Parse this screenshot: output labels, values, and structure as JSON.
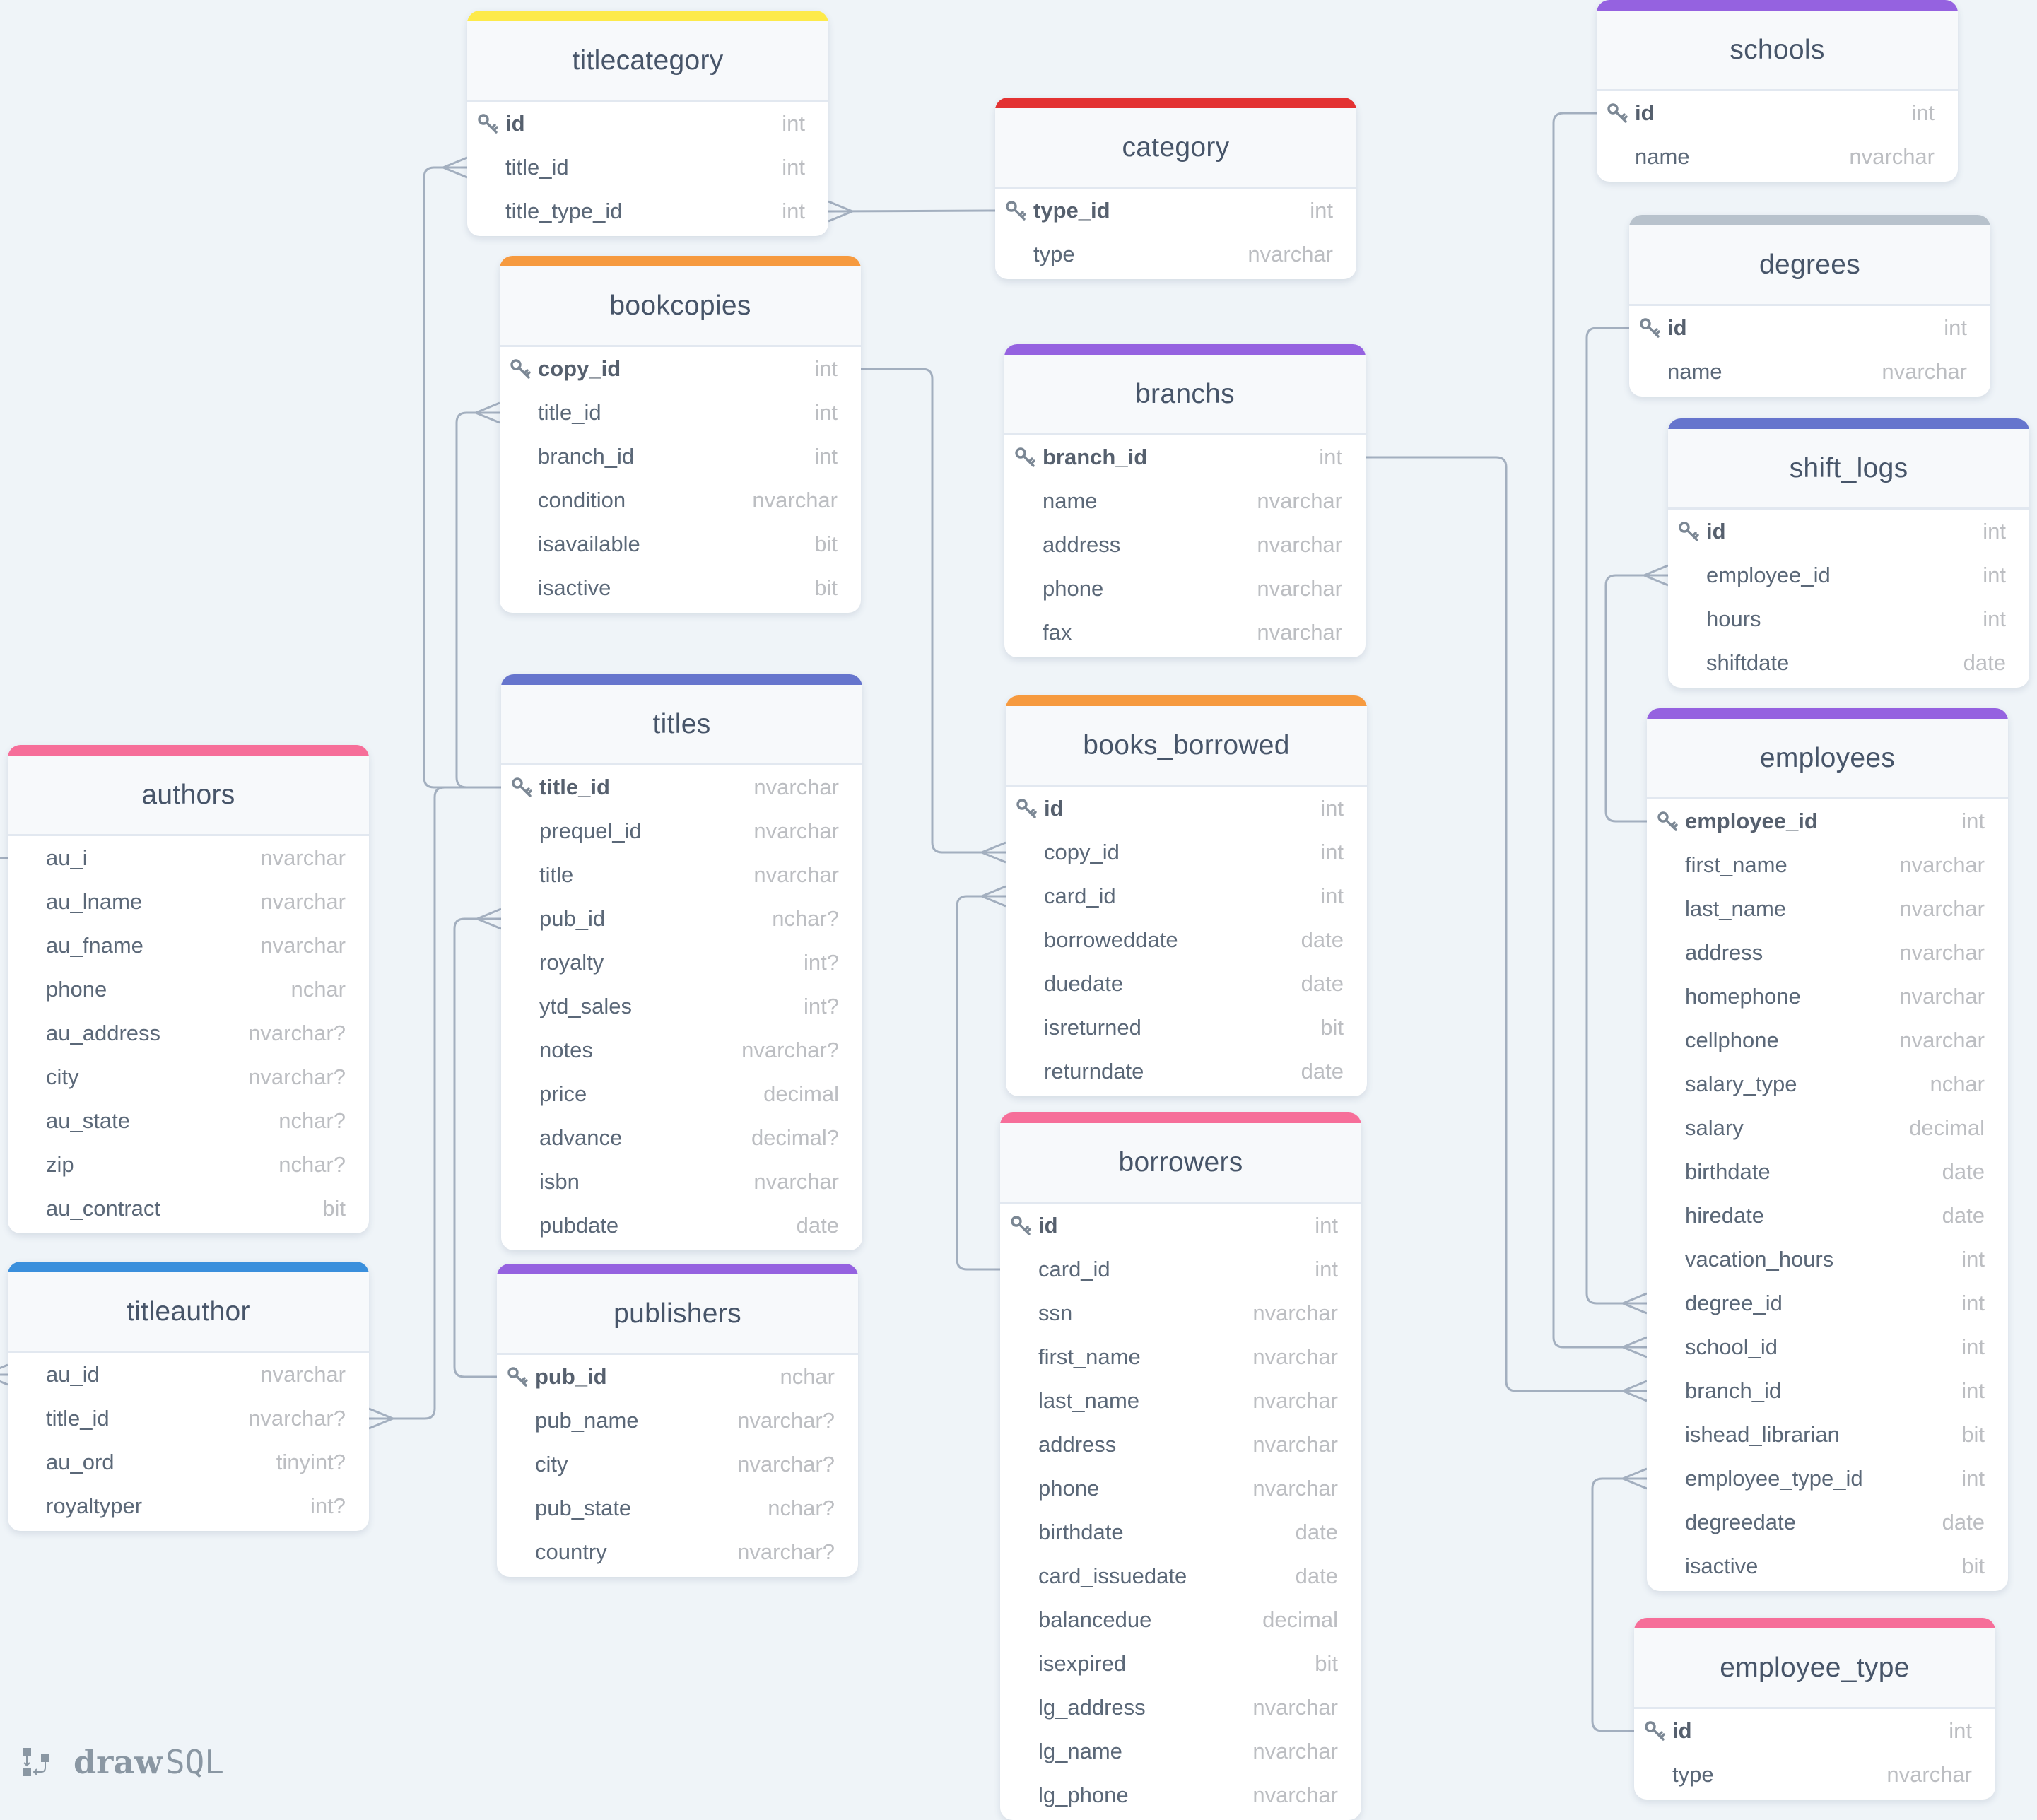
{
  "app": {
    "brand_bold": "draw",
    "brand_light": "SQL"
  },
  "colors": {
    "yellow": "#fdea4a",
    "red": "#e33232",
    "orange": "#f69a3f",
    "purple": "#9562e0",
    "indigo": "#6675cd",
    "pink": "#f66e99",
    "blue": "#3a8fdc",
    "gray": "#b8c2cc",
    "wire": "#a3afbf"
  },
  "tables": [
    {
      "id": "titlecategory",
      "name": "titlecategory",
      "color": "yellow",
      "columns": [
        {
          "name": "id",
          "type": "int",
          "pk": true
        },
        {
          "name": "title_id",
          "type": "int"
        },
        {
          "name": "title_type_id",
          "type": "int"
        }
      ]
    },
    {
      "id": "category",
      "name": "category",
      "color": "red",
      "columns": [
        {
          "name": "type_id",
          "type": "int",
          "pk": true
        },
        {
          "name": "type",
          "type": "nvarchar"
        }
      ]
    },
    {
      "id": "bookcopies",
      "name": "bookcopies",
      "color": "orange",
      "columns": [
        {
          "name": "copy_id",
          "type": "int",
          "pk": true
        },
        {
          "name": "title_id",
          "type": "int"
        },
        {
          "name": "branch_id",
          "type": "int"
        },
        {
          "name": "condition",
          "type": "nvarchar"
        },
        {
          "name": "isavailable",
          "type": "bit"
        },
        {
          "name": "isactive",
          "type": "bit"
        }
      ]
    },
    {
      "id": "branchs",
      "name": "branchs",
      "color": "purple",
      "columns": [
        {
          "name": "branch_id",
          "type": "int",
          "pk": true
        },
        {
          "name": "name",
          "type": "nvarchar"
        },
        {
          "name": "address",
          "type": "nvarchar"
        },
        {
          "name": "phone",
          "type": "nvarchar"
        },
        {
          "name": "fax",
          "type": "nvarchar"
        }
      ]
    },
    {
      "id": "titles",
      "name": "titles",
      "color": "indigo",
      "columns": [
        {
          "name": "title_id",
          "type": "nvarchar",
          "pk": true
        },
        {
          "name": "prequel_id",
          "type": "nvarchar"
        },
        {
          "name": "title",
          "type": "nvarchar"
        },
        {
          "name": "pub_id",
          "type": "nchar?"
        },
        {
          "name": "royalty",
          "type": "int?"
        },
        {
          "name": "ytd_sales",
          "type": "int?"
        },
        {
          "name": "notes",
          "type": "nvarchar?"
        },
        {
          "name": "price",
          "type": "decimal"
        },
        {
          "name": "advance",
          "type": "decimal?"
        },
        {
          "name": "isbn",
          "type": "nvarchar"
        },
        {
          "name": "pubdate",
          "type": "date"
        }
      ]
    },
    {
      "id": "books_borrowed",
      "name": "books_borrowed",
      "color": "orange",
      "columns": [
        {
          "name": "id",
          "type": "int",
          "pk": true
        },
        {
          "name": "copy_id",
          "type": "int"
        },
        {
          "name": "card_id",
          "type": "int"
        },
        {
          "name": "borroweddate",
          "type": "date"
        },
        {
          "name": "duedate",
          "type": "date"
        },
        {
          "name": "isreturned",
          "type": "bit"
        },
        {
          "name": "returndate",
          "type": "date"
        }
      ]
    },
    {
      "id": "borrowers",
      "name": "borrowers",
      "color": "pink",
      "columns": [
        {
          "name": "id",
          "type": "int",
          "pk": true
        },
        {
          "name": "card_id",
          "type": "int"
        },
        {
          "name": "ssn",
          "type": "nvarchar"
        },
        {
          "name": "first_name",
          "type": "nvarchar"
        },
        {
          "name": "last_name",
          "type": "nvarchar"
        },
        {
          "name": "address",
          "type": "nvarchar"
        },
        {
          "name": "phone",
          "type": "nvarchar"
        },
        {
          "name": "birthdate",
          "type": "date"
        },
        {
          "name": "card_issuedate",
          "type": "date"
        },
        {
          "name": "balancedue",
          "type": "decimal"
        },
        {
          "name": "isexpired",
          "type": "bit"
        },
        {
          "name": "lg_address",
          "type": "nvarchar"
        },
        {
          "name": "lg_name",
          "type": "nvarchar"
        },
        {
          "name": "lg_phone",
          "type": "nvarchar"
        }
      ]
    },
    {
      "id": "authors",
      "name": "authors",
      "color": "pink",
      "columns": [
        {
          "name": "au_i",
          "type": "nvarchar"
        },
        {
          "name": "au_lname",
          "type": "nvarchar"
        },
        {
          "name": "au_fname",
          "type": "nvarchar"
        },
        {
          "name": "phone",
          "type": "nchar"
        },
        {
          "name": "au_address",
          "type": "nvarchar?"
        },
        {
          "name": "city",
          "type": "nvarchar?"
        },
        {
          "name": "au_state",
          "type": "nchar?"
        },
        {
          "name": "zip",
          "type": "nchar?"
        },
        {
          "name": "au_contract",
          "type": "bit"
        }
      ]
    },
    {
      "id": "titleauthor",
      "name": "titleauthor",
      "color": "blue",
      "columns": [
        {
          "name": "au_id",
          "type": "nvarchar"
        },
        {
          "name": "title_id",
          "type": "nvarchar?"
        },
        {
          "name": "au_ord",
          "type": "tinyint?"
        },
        {
          "name": "royaltyper",
          "type": "int?"
        }
      ]
    },
    {
      "id": "publishers",
      "name": "publishers",
      "color": "purple",
      "columns": [
        {
          "name": "pub_id",
          "type": "nchar",
          "pk": true
        },
        {
          "name": "pub_name",
          "type": "nvarchar?"
        },
        {
          "name": "city",
          "type": "nvarchar?"
        },
        {
          "name": "pub_state",
          "type": "nchar?"
        },
        {
          "name": "country",
          "type": "nvarchar?"
        }
      ]
    },
    {
      "id": "schools",
      "name": "schools",
      "color": "purple",
      "columns": [
        {
          "name": "id",
          "type": "int",
          "pk": true
        },
        {
          "name": "name",
          "type": "nvarchar"
        }
      ]
    },
    {
      "id": "degrees",
      "name": "degrees",
      "color": "gray",
      "columns": [
        {
          "name": "id",
          "type": "int",
          "pk": true
        },
        {
          "name": "name",
          "type": "nvarchar"
        }
      ]
    },
    {
      "id": "shift_logs",
      "name": "shift_logs",
      "color": "indigo",
      "columns": [
        {
          "name": "id",
          "type": "int",
          "pk": true
        },
        {
          "name": "employee_id",
          "type": "int"
        },
        {
          "name": "hours",
          "type": "int"
        },
        {
          "name": "shiftdate",
          "type": "date"
        }
      ]
    },
    {
      "id": "employees",
      "name": "employees",
      "color": "purple",
      "columns": [
        {
          "name": "employee_id",
          "type": "int",
          "pk": true
        },
        {
          "name": "first_name",
          "type": "nvarchar"
        },
        {
          "name": "last_name",
          "type": "nvarchar"
        },
        {
          "name": "address",
          "type": "nvarchar"
        },
        {
          "name": "homephone",
          "type": "nvarchar"
        },
        {
          "name": "cellphone",
          "type": "nvarchar"
        },
        {
          "name": "salary_type",
          "type": "nchar"
        },
        {
          "name": "salary",
          "type": "decimal"
        },
        {
          "name": "birthdate",
          "type": "date"
        },
        {
          "name": "hiredate",
          "type": "date"
        },
        {
          "name": "vacation_hours",
          "type": "int"
        },
        {
          "name": "degree_id",
          "type": "int"
        },
        {
          "name": "school_id",
          "type": "int"
        },
        {
          "name": "branch_id",
          "type": "int"
        },
        {
          "name": "ishead_librarian",
          "type": "bit"
        },
        {
          "name": "employee_type_id",
          "type": "int"
        },
        {
          "name": "degreedate",
          "type": "date"
        },
        {
          "name": "isactive",
          "type": "bit"
        }
      ]
    },
    {
      "id": "employee_type",
      "name": "employee_type",
      "color": "pink",
      "columns": [
        {
          "name": "id",
          "type": "int",
          "pk": true
        },
        {
          "name": "type",
          "type": "nvarchar"
        }
      ]
    }
  ],
  "relations": [
    {
      "from": "titles.title_id",
      "to": "titlecategory.title_id",
      "cardinality": "one-to-many"
    },
    {
      "from": "category.type_id",
      "to": "titlecategory.title_type_id",
      "cardinality": "one-to-many"
    },
    {
      "from": "titles.title_id",
      "to": "bookcopies.title_id",
      "cardinality": "one-to-many"
    },
    {
      "from": "bookcopies.copy_id",
      "to": "books_borrowed.copy_id",
      "cardinality": "one-to-many"
    },
    {
      "from": "borrowers.card_id",
      "to": "books_borrowed.card_id",
      "cardinality": "one-to-many"
    },
    {
      "from": "publishers.pub_id",
      "to": "titles.pub_id",
      "cardinality": "one-to-many"
    },
    {
      "from": "titles.title_id",
      "to": "titleauthor.title_id",
      "cardinality": "one-to-many"
    },
    {
      "from": "authors.au_i",
      "to": "titleauthor.au_id",
      "cardinality": "one-to-many"
    },
    {
      "from": "schools.id",
      "to": "employees.school_id",
      "cardinality": "one-to-many"
    },
    {
      "from": "degrees.id",
      "to": "employees.degree_id",
      "cardinality": "one-to-many"
    },
    {
      "from": "employees.employee_id",
      "to": "shift_logs.employee_id",
      "cardinality": "one-to-many"
    },
    {
      "from": "branchs.branch_id",
      "to": "employees.branch_id",
      "cardinality": "one-to-many"
    },
    {
      "from": "employee_type.id",
      "to": "employees.employee_type_id",
      "cardinality": "one-to-many"
    }
  ]
}
